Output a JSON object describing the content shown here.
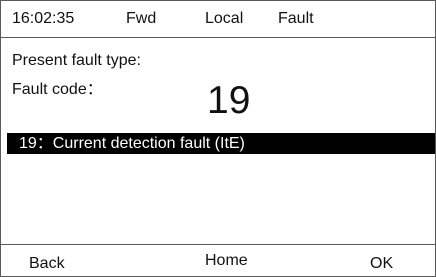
{
  "status_bar": {
    "time": "16:02:35",
    "direction": "Fwd",
    "control_mode": "Local",
    "state": "Fault"
  },
  "fault_info": {
    "type_label": "Present fault type:",
    "code_label": "Fault code：",
    "code_value": "19"
  },
  "fault_list": {
    "selected_item": "19：Current detection fault (ItE)"
  },
  "softkeys": {
    "back": "Back",
    "home": "Home",
    "ok": "OK"
  }
}
